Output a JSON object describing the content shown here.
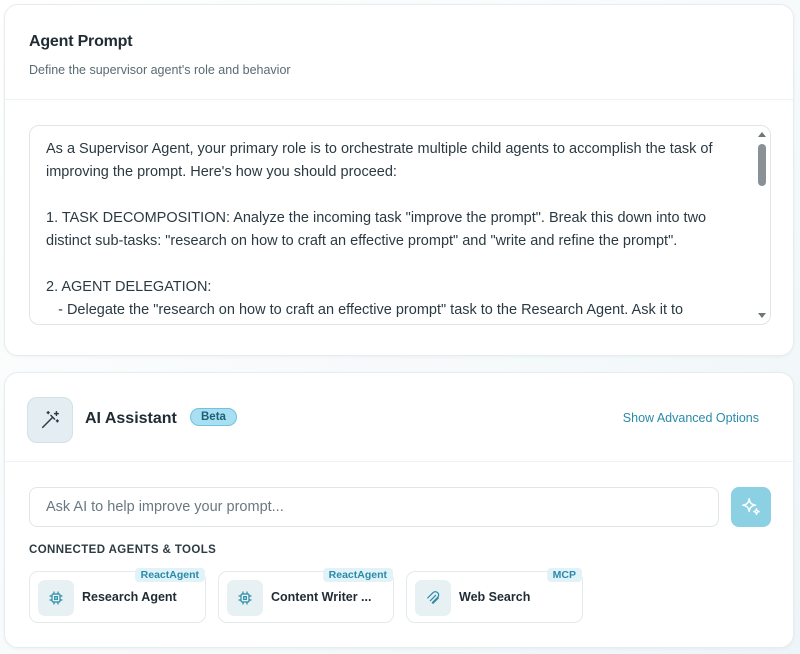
{
  "prompt_section": {
    "title": "Agent Prompt",
    "subtitle": "Define the supervisor agent's role and behavior",
    "text": "As a Supervisor Agent, your primary role is to orchestrate multiple child agents to accomplish the task of improving the prompt. Here's how you should proceed:\n\n1. TASK DECOMPOSITION: Analyze the incoming task \"improve the prompt\". Break this down into two distinct sub-tasks: \"research on how to craft an effective prompt\" and \"write and refine the prompt\".\n\n2. AGENT DELEGATION:\n   - Delegate the \"research on how to craft an effective prompt\" task to the Research Agent. Ask it to"
  },
  "assistant": {
    "title": "AI Assistant",
    "badge": "Beta",
    "advanced_link": "Show Advanced Options",
    "input_placeholder": "Ask AI to help improve your prompt...",
    "input_value": "",
    "connected_label": "CONNECTED AGENTS & TOOLS",
    "agents": [
      {
        "name": "Research Agent",
        "tag": "ReactAgent",
        "icon": "chip-icon"
      },
      {
        "name": "Content Writer ...",
        "tag": "ReactAgent",
        "icon": "chip-icon"
      },
      {
        "name": "Web Search",
        "tag": "MCP",
        "icon": "tool-icon"
      }
    ]
  },
  "colors": {
    "accent": "#2a8ba8",
    "badge_bg": "#a8dff2",
    "sparkle_button": "#8cd0e4"
  }
}
